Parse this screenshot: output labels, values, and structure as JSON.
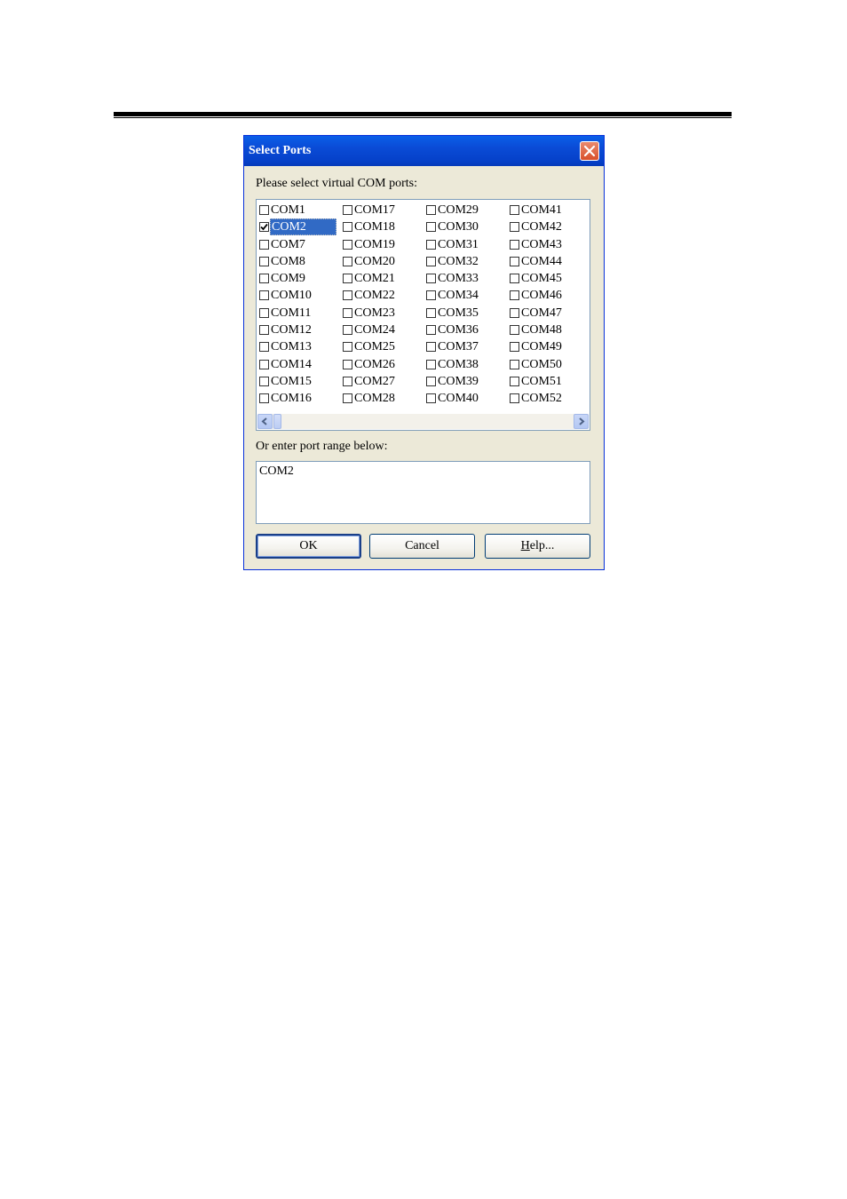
{
  "dialog": {
    "title": "Select Ports",
    "list_label": "Please select virtual COM ports:",
    "range_label": "Or enter port range below:",
    "range_value": "COM2",
    "ports": [
      {
        "label": "COM1",
        "checked": false
      },
      {
        "label": "COM17",
        "checked": false
      },
      {
        "label": "COM29",
        "checked": false
      },
      {
        "label": "COM41",
        "checked": false
      },
      {
        "label": "COM2",
        "checked": true
      },
      {
        "label": "COM18",
        "checked": false
      },
      {
        "label": "COM30",
        "checked": false
      },
      {
        "label": "COM42",
        "checked": false
      },
      {
        "label": "COM7",
        "checked": false
      },
      {
        "label": "COM19",
        "checked": false
      },
      {
        "label": "COM31",
        "checked": false
      },
      {
        "label": "COM43",
        "checked": false
      },
      {
        "label": "COM8",
        "checked": false
      },
      {
        "label": "COM20",
        "checked": false
      },
      {
        "label": "COM32",
        "checked": false
      },
      {
        "label": "COM44",
        "checked": false
      },
      {
        "label": "COM9",
        "checked": false
      },
      {
        "label": "COM21",
        "checked": false
      },
      {
        "label": "COM33",
        "checked": false
      },
      {
        "label": "COM45",
        "checked": false
      },
      {
        "label": "COM10",
        "checked": false
      },
      {
        "label": "COM22",
        "checked": false
      },
      {
        "label": "COM34",
        "checked": false
      },
      {
        "label": "COM46",
        "checked": false
      },
      {
        "label": "COM11",
        "checked": false
      },
      {
        "label": "COM23",
        "checked": false
      },
      {
        "label": "COM35",
        "checked": false
      },
      {
        "label": "COM47",
        "checked": false
      },
      {
        "label": "COM12",
        "checked": false
      },
      {
        "label": "COM24",
        "checked": false
      },
      {
        "label": "COM36",
        "checked": false
      },
      {
        "label": "COM48",
        "checked": false
      },
      {
        "label": "COM13",
        "checked": false
      },
      {
        "label": "COM25",
        "checked": false
      },
      {
        "label": "COM37",
        "checked": false
      },
      {
        "label": "COM49",
        "checked": false
      },
      {
        "label": "COM14",
        "checked": false
      },
      {
        "label": "COM26",
        "checked": false
      },
      {
        "label": "COM38",
        "checked": false
      },
      {
        "label": "COM50",
        "checked": false
      },
      {
        "label": "COM15",
        "checked": false
      },
      {
        "label": "COM27",
        "checked": false
      },
      {
        "label": "COM39",
        "checked": false
      },
      {
        "label": "COM51",
        "checked": false
      },
      {
        "label": "COM16",
        "checked": false
      },
      {
        "label": "COM28",
        "checked": false
      },
      {
        "label": "COM40",
        "checked": false
      },
      {
        "label": "COM52",
        "checked": false
      }
    ],
    "buttons": {
      "ok": "OK",
      "cancel": "Cancel",
      "help": "Help..."
    }
  }
}
